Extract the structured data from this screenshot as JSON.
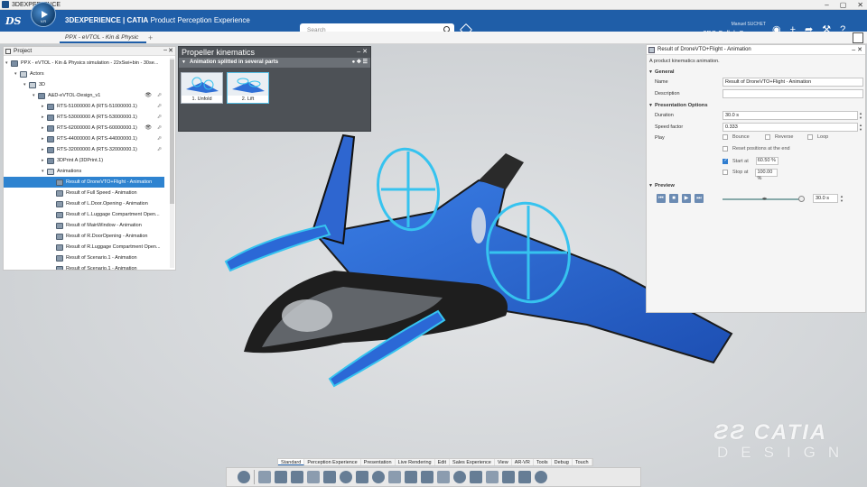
{
  "window": {
    "title": "3DEXPERIENCE"
  },
  "header": {
    "compass_version": "V.R",
    "brand_bold": "3DEXPERIENCE | CATIA",
    "brand_app": "Product Perception Experience",
    "search_placeholder": "Search",
    "user_name": "Manuel SUCHET",
    "collab_space": "3DS Collab Space"
  },
  "doc_tab": {
    "label": "PPX - eVTOL - Kin & Physic"
  },
  "project_panel": {
    "title": "Project",
    "tree": [
      {
        "label": "PPX - eVTOL - Kin & Physics simulation - 22xSwi+bin - 30se...",
        "level": 0,
        "icon": "product-icon"
      },
      {
        "label": "Actors",
        "level": 1,
        "icon": "folder-icon"
      },
      {
        "label": "3D",
        "level": 2,
        "icon": "folder-icon"
      },
      {
        "label": "A&D-eVTOL-Design_v1",
        "level": 3,
        "icon": "assembly-icon",
        "eye": true,
        "pin": true
      },
      {
        "label": "RTS-51000000 A (RTS-51000000.1)",
        "level": 4,
        "icon": "part-icon",
        "pin": true
      },
      {
        "label": "RTS-53000000 A (RTS-53000000.1)",
        "level": 4,
        "icon": "part-icon",
        "pin": true
      },
      {
        "label": "RTS-62000000 A (RTS-60000000.1)",
        "level": 4,
        "icon": "part-icon",
        "eye": true,
        "pin": true
      },
      {
        "label": "RTS-44000000 A (RTS-44000000.1)",
        "level": 4,
        "icon": "part-icon",
        "pin": true
      },
      {
        "label": "RTS-32000000 A (RTS-32000000.1)",
        "level": 4,
        "icon": "part-icon",
        "pin": true
      },
      {
        "label": "3DPrint A (3DPrint.1)",
        "level": 4,
        "icon": "part-icon"
      },
      {
        "label": "Animations",
        "level": 4,
        "icon": "folder-icon"
      },
      {
        "label": "Result of DroneVTO+Flight - Animation",
        "level": 5,
        "icon": "animation-icon",
        "selected": true
      },
      {
        "label": "Result of Full Speed - Animation",
        "level": 5,
        "icon": "animation-icon"
      },
      {
        "label": "Result of L.Door.Opening - Animation",
        "level": 5,
        "icon": "animation-icon"
      },
      {
        "label": "Result of L.Luggage Compartment Open...",
        "level": 5,
        "icon": "animation-icon"
      },
      {
        "label": "Result of MainWindow - Animation",
        "level": 5,
        "icon": "animation-icon"
      },
      {
        "label": "Result of R.DoorOpening - Animation",
        "level": 5,
        "icon": "animation-icon"
      },
      {
        "label": "Result of R.Luggage Compartment Open...",
        "level": 5,
        "icon": "animation-icon"
      },
      {
        "label": "Result of Scenario.1 - Animation",
        "level": 5,
        "icon": "animation-icon"
      },
      {
        "label": "Result of Scenario.1 - Animation",
        "level": 5,
        "icon": "animation-icon"
      }
    ]
  },
  "kinematics_panel": {
    "title": "Propeller kinematics",
    "subtitle": "Animation splitted in several parts",
    "thumbnails": [
      {
        "label": "1. Unfold"
      },
      {
        "label": "2. Lift"
      }
    ]
  },
  "properties_panel": {
    "title": "Result of DroneVTO+Flight - Animation",
    "description": "A product kinematics animation.",
    "general": {
      "section": "General",
      "name_label": "Name",
      "name_value": "Result of DroneVTO+Flight - Animation",
      "description_label": "Description",
      "description_value": ""
    },
    "presentation": {
      "section": "Presentation Options",
      "duration_label": "Duration",
      "duration_value": "30.0 s",
      "speed_label": "Speed factor",
      "speed_value": "0.333",
      "play_label": "Play",
      "bounce": "Bounce",
      "reverse": "Reverse",
      "loop": "Loop",
      "reset": "Reset positions at the end",
      "start_at": "Start at",
      "start_at_value": "60.50 %",
      "stop_at": "Stop at",
      "stop_at_value": "100.00 %"
    },
    "preview": {
      "section": "Preview",
      "time_value": "30.0 s",
      "progress": 1.0
    }
  },
  "action_tabs": [
    "Standard",
    "Perception Experience",
    "Presentation",
    "Live Rendering",
    "Edit",
    "Sales Experience",
    "View",
    "AR-VR",
    "Tools",
    "Debug",
    "Touch"
  ],
  "watermark": {
    "brand": "CATIA",
    "sub": "DESIGN"
  },
  "colors": {
    "header": "#1f5ea8",
    "selection": "#2e83d0",
    "aircraft_blue": "#2f6fd6",
    "highlight": "#36c3ef"
  }
}
